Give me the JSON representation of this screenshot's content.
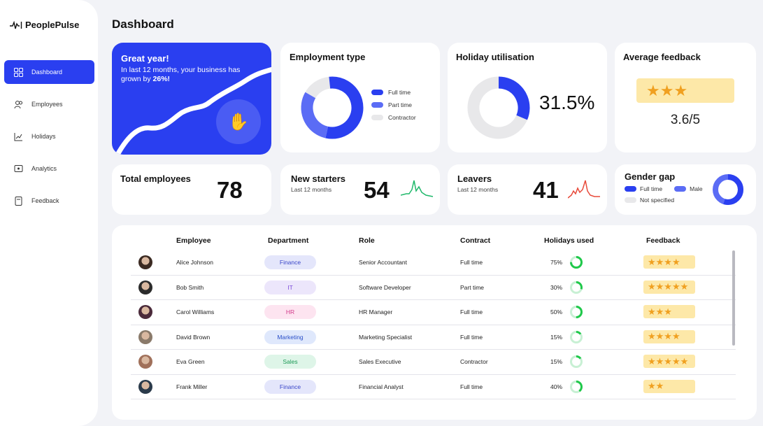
{
  "app": {
    "name": "PeoplePulse"
  },
  "sidebar": {
    "items": [
      {
        "label": "Dashboard",
        "icon": "grid-icon",
        "active": true
      },
      {
        "label": "Employees",
        "icon": "users-icon",
        "active": false
      },
      {
        "label": "Holidays",
        "icon": "chart-icon",
        "active": false
      },
      {
        "label": "Analytics",
        "icon": "analytics-icon",
        "active": false
      },
      {
        "label": "Feedback",
        "icon": "feedback-icon",
        "active": false
      }
    ]
  },
  "page": {
    "title": "Dashboard"
  },
  "hero": {
    "title": "Great year!",
    "text_prefix": "In last 12 months, your business has grown by ",
    "highlight": "26%!",
    "icon": "clapping-hands-icon"
  },
  "employment_type": {
    "title": "Employment type",
    "legend": [
      {
        "label": "Full time",
        "color": "#2a3ff0"
      },
      {
        "label": "Part time",
        "color": "#5b6cf5"
      },
      {
        "label": "Contractor",
        "color": "#e8e8ea"
      }
    ],
    "chart_data": {
      "type": "pie",
      "slices": [
        {
          "label": "Full time",
          "value": 55
        },
        {
          "label": "Part time",
          "value": 30
        },
        {
          "label": "Contractor",
          "value": 15
        }
      ]
    }
  },
  "holiday": {
    "title": "Holiday utilisation",
    "value_text": "31.5%",
    "fraction": 0.315
  },
  "feedback": {
    "title": "Average feedback",
    "stars": "★★★",
    "score": "3.6/5"
  },
  "total_employees": {
    "title": "Total employees",
    "value": "78"
  },
  "new_starters": {
    "title": "New starters",
    "subtitle": "Last 12 months",
    "value": "54",
    "spark_color": "#1fb86a"
  },
  "leavers": {
    "title": "Leavers",
    "subtitle": "Last 12 months",
    "value": "41",
    "spark_color": "#e84a3a"
  },
  "gender_gap": {
    "title": "Gender gap",
    "legend": [
      {
        "label": "Full time",
        "color": "#2a3ff0"
      },
      {
        "label": "Male",
        "color": "#5b6cf5"
      },
      {
        "label": "Not specified",
        "color": "#e8e8ea"
      }
    ]
  },
  "table": {
    "headers": [
      "Employee",
      "Department",
      "Role",
      "Contract",
      "Holidays used",
      "Feedback"
    ],
    "rows": [
      {
        "name": "Alice Johnson",
        "dept": "Finance",
        "role": "Senior Accountant",
        "contract": "Full time",
        "holidays": "75%",
        "holidays_fraction": 0.75,
        "stars": "★★★★"
      },
      {
        "name": "Bob Smith",
        "dept": "IT",
        "role": "Software Developer",
        "contract": "Part time",
        "holidays": "30%",
        "holidays_fraction": 0.3,
        "stars": "★★★★★"
      },
      {
        "name": "Carol Williams",
        "dept": "HR",
        "role": "HR Manager",
        "contract": "Full time",
        "holidays": "50%",
        "holidays_fraction": 0.5,
        "stars": "★★★"
      },
      {
        "name": "David Brown",
        "dept": "Marketing",
        "role": "Marketing Specialist",
        "contract": "Full time",
        "holidays": "15%",
        "holidays_fraction": 0.15,
        "stars": "★★★★"
      },
      {
        "name": "Eva Green",
        "dept": "Sales",
        "role": "Sales Executive",
        "contract": "Contractor",
        "holidays": "15%",
        "holidays_fraction": 0.15,
        "stars": "★★★★★"
      },
      {
        "name": "Frank Miller",
        "dept": "Finance",
        "role": "Financial Analyst",
        "contract": "Full time",
        "holidays": "40%",
        "holidays_fraction": 0.4,
        "stars": "★★"
      }
    ]
  },
  "dept_colors": {
    "Finance": {
      "bg": "#e4e6fb",
      "fg": "#3a46c8"
    },
    "IT": {
      "bg": "#ece6fb",
      "fg": "#7a4ad8"
    },
    "HR": {
      "bg": "#fde4f0",
      "fg": "#d23a8a"
    },
    "Marketing": {
      "bg": "#dfe8fc",
      "fg": "#2a4fc8"
    },
    "Sales": {
      "bg": "#def5e8",
      "fg": "#1d9a56"
    }
  }
}
